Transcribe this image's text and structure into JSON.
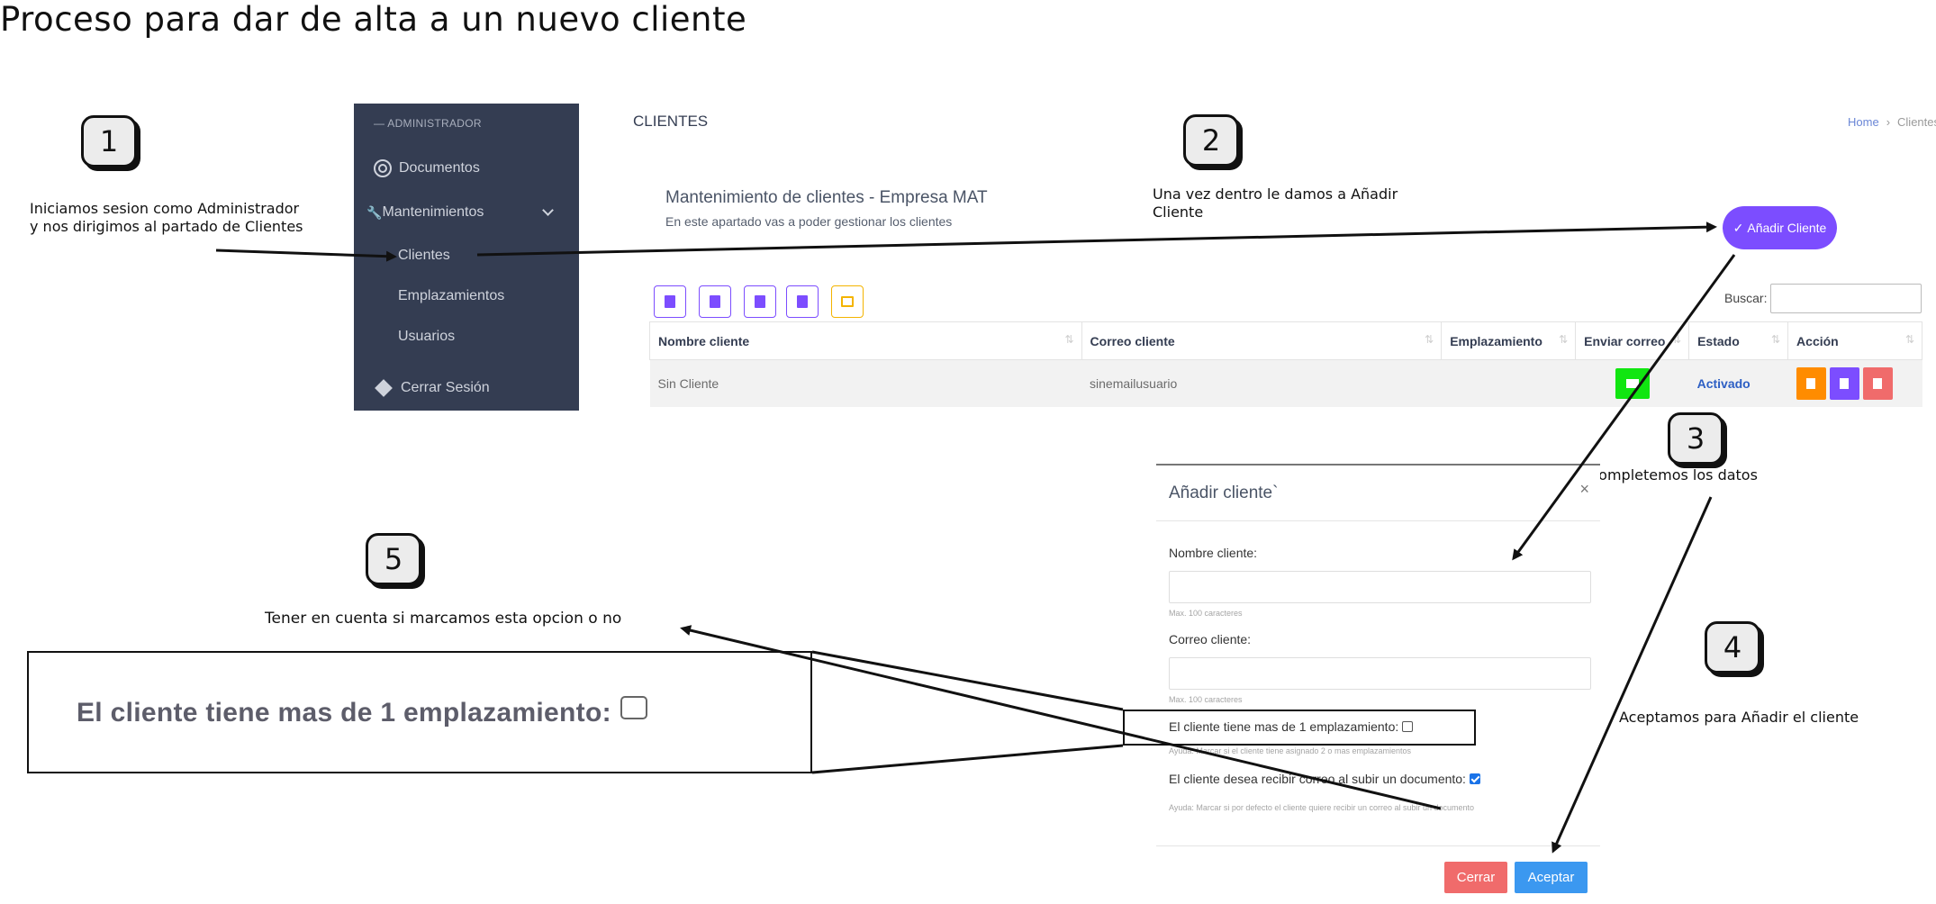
{
  "title": "Proceso para dar de alta a un nuevo cliente",
  "steps": [
    {
      "num": "1",
      "text_line1": "Iniciamos sesion como Administrador",
      "text_line2": "y nos dirigimos al partado de Clientes"
    },
    {
      "num": "2",
      "text_line1": "Una vez dentro le damos a Añadir",
      "text_line2": "Cliente"
    },
    {
      "num": "3",
      "text": "Completemos los datos"
    },
    {
      "num": "4",
      "text": "Aceptamos para Añadir el cliente"
    },
    {
      "num": "5",
      "text": "Tener en cuenta si marcamos esta opcion o no"
    }
  ],
  "sidebar": {
    "header": "ADMINISTRADOR",
    "items": [
      "Documentos",
      "Mantenimientos",
      "Clientes",
      "Emplazamientos",
      "Usuarios",
      "Cerrar Sesión"
    ]
  },
  "page": {
    "title": "CLIENTES",
    "breadcrumb": [
      "Home",
      "Clientes"
    ],
    "section_title": "Mantenimiento de clientes - Empresa MAT",
    "section_subtitle": "En este apartado vas a poder gestionar los clientes",
    "add_button": "Añadir Cliente",
    "search_label": "Buscar:"
  },
  "table": {
    "columns": [
      "Nombre cliente",
      "Correo cliente",
      "Emplazamiento",
      "Enviar correo",
      "Estado",
      "Acción"
    ],
    "rows": [
      {
        "nombre": "Sin Cliente",
        "correo": "sinemailusuario",
        "emplazamiento": "",
        "estado": "Activado"
      }
    ]
  },
  "modal": {
    "title": "Añadir cliente`",
    "close": "×",
    "name_label": "Nombre cliente:",
    "name_value": "",
    "name_help": "Max. 100 caracteres",
    "email_label": "Correo cliente:",
    "email_value": "",
    "email_help": "Max. 100 caracteres",
    "multi_label": "El cliente tiene mas de 1 emplazamiento:",
    "multi_checked": false,
    "multi_help": "Ayuda: Marcar si el cliente tiene asignado 2 o mas emplazamientos",
    "notify_label": "El cliente desea recibir correo al subir un documento:",
    "notify_checked": true,
    "notify_help": "Ayuda: Marcar si por defecto el cliente quiere recibir un correo al subir un documento",
    "cancel": "Cerrar",
    "accept": "Aceptar"
  },
  "zoom_label": "El cliente tiene mas de 1 emplazamiento:",
  "colors": {
    "sidebar_bg": "#343d52",
    "accent_purple": "#7c4dff",
    "send_mail_green": "#11e611",
    "accept_blue": "#3b98f0",
    "cancel_red": "#f06b6b",
    "action_orange": "#ff8c00"
  }
}
